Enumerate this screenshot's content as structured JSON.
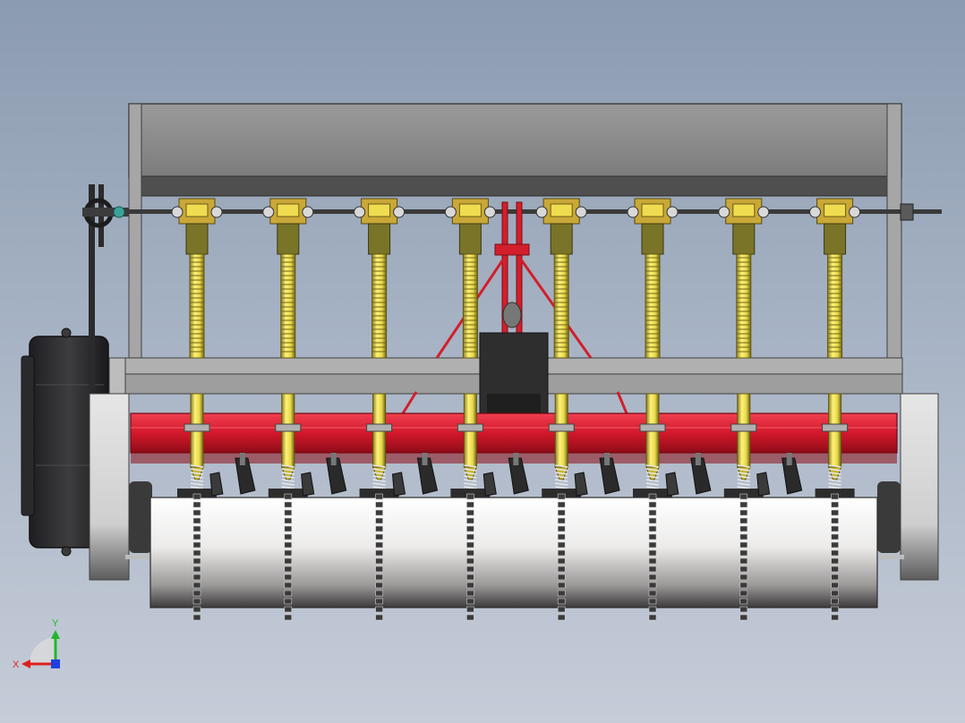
{
  "view": {
    "background_top": "#8b9bb0",
    "background_bottom": "#c6ccd8"
  },
  "model": {
    "row_units": 8,
    "colors": {
      "frame_gray": "#8e8e8e",
      "frame_dark": "#5a5a5a",
      "toolbar_red": "#d3182b",
      "tube_yellow": "#e6d84a",
      "tube_shadow": "#8c7f1e",
      "metering_olive": "#7a7428",
      "roller_white": "#f4f4f2",
      "gearbox_black": "#2f2f31",
      "hitch_red": "#d21f2b"
    }
  },
  "triad": {
    "x_label": "X",
    "y_label": "Y",
    "x_color": "#e01f1f",
    "y_color": "#1fb82a",
    "z_color": "#1f3fe0"
  }
}
